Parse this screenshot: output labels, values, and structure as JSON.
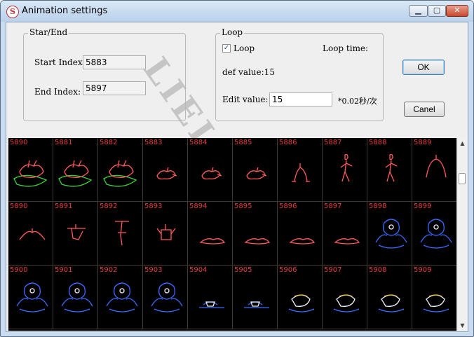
{
  "window": {
    "title": "Animation settings",
    "app_icon_glyph": "S",
    "icons": {
      "app": "app-logo-icon",
      "min": "minimize-icon",
      "max": "maximize-icon",
      "close": "close-icon"
    },
    "controls": {
      "minimize": "▁",
      "maximize": "▢",
      "close": "✕"
    }
  },
  "start_end": {
    "group_label": "Star/End",
    "start_label": "Start Index:",
    "start_value": "5883",
    "end_label": "End Index:",
    "end_value": "5897"
  },
  "loop": {
    "group_label": "Loop",
    "checkbox_label": "Loop",
    "checked": true,
    "check_mark": "✓",
    "loop_time_label": "Loop time:",
    "def_value_text": "def value:15",
    "edit_label": "Edit value:",
    "edit_value": "15",
    "unit_text": "*0.02秒/次"
  },
  "buttons": {
    "ok": "OK",
    "cancel": "Canel"
  },
  "watermark": "LIELASER",
  "scrollbar": {
    "up_arrow": "▲",
    "down_arrow": "▼"
  },
  "colors": {
    "red": "#ff5a5a",
    "green": "#3cd23c",
    "blue": "#3a6cff",
    "white": "#f0f0ff",
    "gold": "#e6c840",
    "label": "#e23b3b"
  },
  "frames": [
    {
      "label": "5890",
      "shape": "rabbit-leaf"
    },
    {
      "label": "5881",
      "shape": "rabbit-leaf"
    },
    {
      "label": "5882",
      "shape": "rabbit-leaf"
    },
    {
      "label": "5883",
      "shape": "small-crouch"
    },
    {
      "label": "5884",
      "shape": "small-crouch"
    },
    {
      "label": "5885",
      "shape": "small-crouch"
    },
    {
      "label": "5886",
      "shape": "kneel"
    },
    {
      "label": "5887",
      "shape": "standing"
    },
    {
      "label": "5888",
      "shape": "standing"
    },
    {
      "label": "5889",
      "shape": "arch"
    },
    {
      "label": "5890",
      "shape": "bow"
    },
    {
      "label": "5891",
      "shape": "flip"
    },
    {
      "label": "5892",
      "shape": "handstand"
    },
    {
      "label": "5893",
      "shape": "crab"
    },
    {
      "label": "5894",
      "shape": "lying"
    },
    {
      "label": "5895",
      "shape": "lying"
    },
    {
      "label": "5896",
      "shape": "lying"
    },
    {
      "label": "5897",
      "shape": "lying"
    },
    {
      "label": "5898",
      "shape": "ape"
    },
    {
      "label": "5899",
      "shape": "ape"
    },
    {
      "label": "5900",
      "shape": "ape"
    },
    {
      "label": "5901",
      "shape": "ape"
    },
    {
      "label": "5902",
      "shape": "ape"
    },
    {
      "label": "5903",
      "shape": "ape"
    },
    {
      "label": "5904",
      "shape": "wreck"
    },
    {
      "label": "5905",
      "shape": "wreck"
    },
    {
      "label": "5906",
      "shape": "mixed"
    },
    {
      "label": "5907",
      "shape": "mixed"
    },
    {
      "label": "5908",
      "shape": "mixed"
    },
    {
      "label": "5909",
      "shape": "mixed"
    }
  ]
}
